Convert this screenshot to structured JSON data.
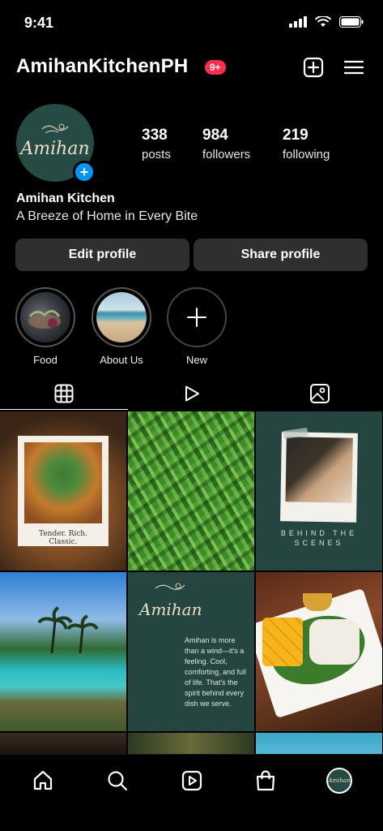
{
  "status_bar": {
    "time": "9:41"
  },
  "header": {
    "username": "AmihanKitchenPH",
    "notification_badge": "9+"
  },
  "profile": {
    "avatar_text": "Amihan",
    "stats": [
      {
        "value": "338",
        "label": "posts"
      },
      {
        "value": "984",
        "label": "followers"
      },
      {
        "value": "219",
        "label": "following"
      }
    ],
    "display_name": "Amihan Kitchen",
    "bio": "A Breeze of Home in Every Bite"
  },
  "actions": {
    "edit_label": "Edit profile",
    "share_label": "Share profile"
  },
  "highlights": [
    {
      "label": "Food"
    },
    {
      "label": "About Us"
    },
    {
      "label": "New"
    }
  ],
  "posts": {
    "p1_caption": "Tender. Rich. Classic.",
    "p3_caption": "BEHIND THE SCENES",
    "p5_title": "Amihan",
    "p5_text": "Amihan is more than a wind—it's a feeling. Cool, comforting, and full of life. That's the spirit behind every dish we serve."
  },
  "nav": {
    "avatar_text": "Amihan"
  },
  "colors": {
    "accent_blue": "#0095f6",
    "badge_red": "#ff2e4d",
    "brand_green": "#264a44",
    "button_gray": "#2f2f2f"
  }
}
